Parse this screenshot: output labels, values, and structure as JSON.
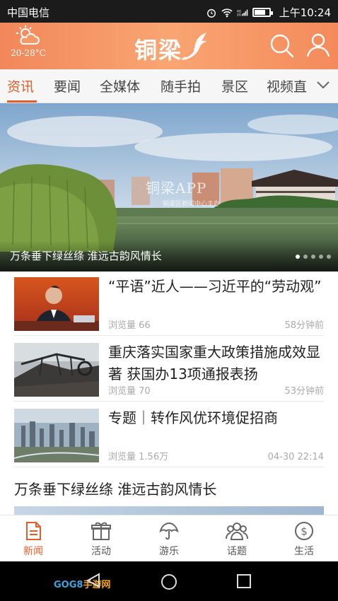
{
  "status_bar": {
    "carrier": "中国电信",
    "time": "上午10:24"
  },
  "header": {
    "weather_icon": "partly-cloudy-icon",
    "temperature": "20-28°C",
    "logo_text": "铜梁"
  },
  "tabs": [
    {
      "label": "资讯",
      "active": true
    },
    {
      "label": "要闻"
    },
    {
      "label": "全媒体"
    },
    {
      "label": "随手拍"
    },
    {
      "label": "景区"
    },
    {
      "label": "视频直"
    }
  ],
  "banner": {
    "caption": "万条垂下绿丝绦 淮远古韵风情长",
    "watermark": "铜梁APP",
    "watermark_sub": "铜梁区新闻中心主办",
    "dot_count": 5,
    "active_dot": 1
  },
  "news": [
    {
      "title": "“平语”近人——习近平的“劳动观”",
      "views_label": "浏览量",
      "views": "66",
      "time": "58分钟前"
    },
    {
      "title": "重庆落实国家重大政策措施成效显著  获国办13项通报表扬",
      "views_label": "浏览量",
      "views": "70",
      "time": "53分钟前"
    },
    {
      "title": "专题｜转作风优环境促招商",
      "views_label": "浏览量",
      "views": "1.56万",
      "time": "04-30 22:14"
    }
  ],
  "headline_2": "万条垂下绿丝绦 淮远古韵风情长",
  "bottom_nav": [
    {
      "label": "新闻",
      "icon": "news-icon",
      "active": true
    },
    {
      "label": "活动",
      "icon": "gift-icon"
    },
    {
      "label": "游乐",
      "icon": "umbrella-icon"
    },
    {
      "label": "话题",
      "icon": "people-icon"
    },
    {
      "label": "生活",
      "icon": "dollar-icon"
    }
  ],
  "watermark_bottom": {
    "part1": "GOG8",
    "part2": "手游网"
  },
  "colors": {
    "accent": "#e35d2a",
    "header": "#f59a66"
  }
}
